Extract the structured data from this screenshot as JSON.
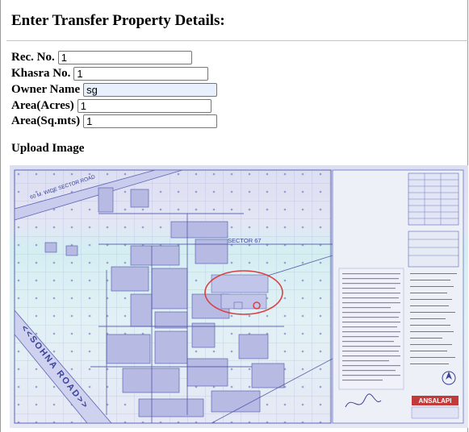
{
  "form": {
    "heading": "Enter Transfer Property Details:",
    "fields": [
      {
        "label": "Rec. No.",
        "value": "1"
      },
      {
        "label": "Khasra No.",
        "value": "1"
      },
      {
        "label": "Owner Name",
        "value": "sg"
      },
      {
        "label": "Area(Acres)",
        "value": "1"
      },
      {
        "label": "Area(Sq.mts)",
        "value": "1"
      }
    ]
  },
  "upload": {
    "label": "Upload Image"
  },
  "map": {
    "road_label_top": "60 M.  WIDE  SECTOR  ROAD",
    "road_label_left": "<<SOHNA ROAD>>",
    "sector_label": "SECTOR 67",
    "brand_logo": "ANSALAPI",
    "colors": {
      "highlight_circle": "#d94040",
      "grid": "#7b82c4",
      "tint_top": "#dfe0f3",
      "tint_mid": "#d6eef3"
    }
  }
}
